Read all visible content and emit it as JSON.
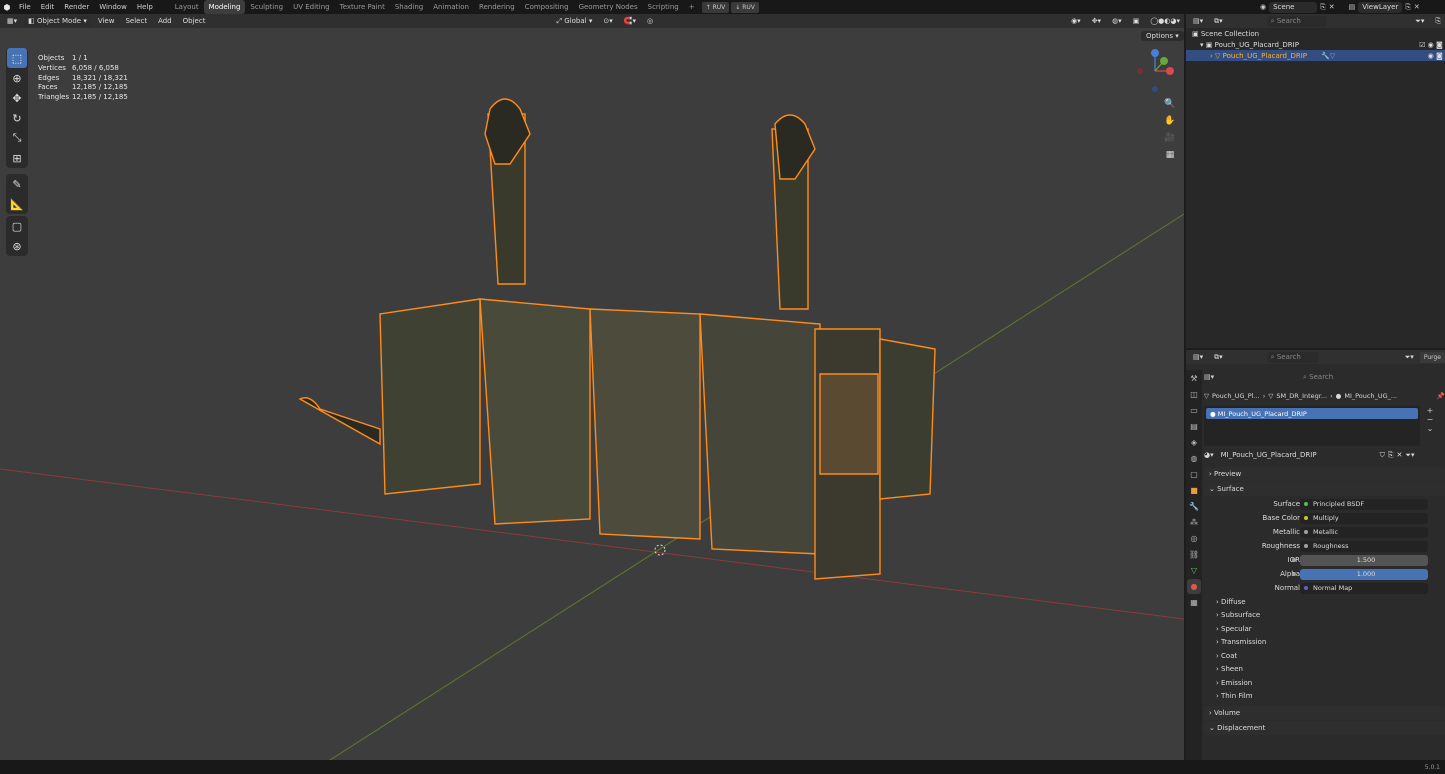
{
  "menu": [
    "File",
    "Edit",
    "Render",
    "Window",
    "Help"
  ],
  "workspaces": [
    "Layout",
    "Modeling",
    "Sculpting",
    "UV Editing",
    "Texture Paint",
    "Shading",
    "Animation",
    "Rendering",
    "Compositing",
    "Geometry Nodes",
    "Scripting"
  ],
  "active_workspace": "Modeling",
  "top_buttons": [
    "RUV",
    "RUV"
  ],
  "scene_name": "Scene",
  "view_layer": "ViewLayer",
  "viewport": {
    "mode": "Object Mode",
    "menus": [
      "View",
      "Select",
      "Add",
      "Object"
    ],
    "orientation": "Global",
    "options_label": "Options",
    "stats": [
      {
        "key": "Objects",
        "value": "1 / 1"
      },
      {
        "key": "Vertices",
        "value": "6,058 / 6,058"
      },
      {
        "key": "Edges",
        "value": "18,321 / 18,321"
      },
      {
        "key": "Faces",
        "value": "12,185 / 12,185"
      },
      {
        "key": "Triangles",
        "value": "12,185 / 12,185"
      }
    ],
    "tools": [
      "select-box",
      "cursor",
      "move",
      "rotate",
      "scale",
      "transform",
      "annotate",
      "measure",
      "add-cube",
      "transform-icon"
    ]
  },
  "outliner": {
    "search_placeholder": "Search",
    "scene_collection": "Scene Collection",
    "collection": "Pouch_UG_Placard_DRIP",
    "object": "Pouch_UG_Placard_DRIP"
  },
  "properties": {
    "search_placeholder": "Search",
    "purge_label": "Purge",
    "breadcrumb": [
      "Pouch_UG_Pl...",
      "SM_DR_Integr...",
      "MI_Pouch_UG_..."
    ],
    "material_slot": "MI_Pouch_UG_Placard_DRIP",
    "material_name": "MI_Pouch_UG_Placard_DRIP",
    "panels": {
      "preview": "Preview",
      "surface": "Surface"
    },
    "surface_rows": [
      {
        "label": "Surface",
        "value": "Principled BSDF",
        "dot": "#4fbf5a"
      },
      {
        "label": "Base Color",
        "value": "Multiply",
        "dot": "#c7c729"
      },
      {
        "label": "Metallic",
        "value": "Metallic",
        "dot": "#a1a1a1"
      },
      {
        "label": "Roughness",
        "value": "Roughness",
        "dot": "#a1a1a1"
      },
      {
        "label": "IOR",
        "value": "1.500",
        "dot": "#a1a1a1"
      },
      {
        "label": "Alpha",
        "value": "1.000",
        "dot": "#a1a1a1"
      },
      {
        "label": "Normal",
        "value": "Normal Map",
        "dot": "#6363c7"
      }
    ],
    "subpanels": [
      "Diffuse",
      "Subsurface",
      "Specular",
      "Transmission",
      "Coat",
      "Sheen",
      "Emission",
      "Thin Film"
    ],
    "bottom_panels": [
      "Volume",
      "Displacement"
    ]
  },
  "version": "5.0.1"
}
